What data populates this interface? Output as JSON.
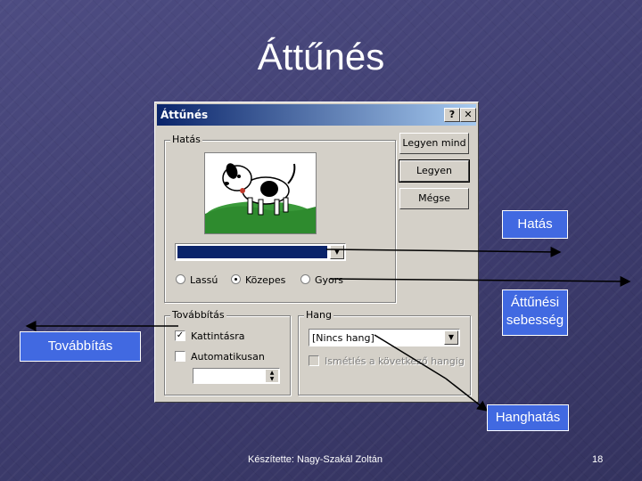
{
  "slide": {
    "title": "Áttűnés",
    "footer_author": "Készítette: Nagy-Szakál Zoltán",
    "page_number": "18"
  },
  "dialog": {
    "title": "Áttűnés",
    "help_button": "?",
    "close_button": "✕",
    "effect_group_label": "Hatás",
    "picture_icon": "dog-picture-icon",
    "effect_select_value": "",
    "speed_options": [
      {
        "label": "Lassú",
        "selected": false
      },
      {
        "label": "Közepes",
        "selected": true
      },
      {
        "label": "Gyors",
        "selected": false
      }
    ],
    "buttons": {
      "apply_all": "Legyen mind",
      "apply": "Legyen",
      "cancel": "Mégse"
    },
    "advance_group_label": "Továbbítás",
    "advance_on_click": "Kattintásra",
    "advance_on_click_checked": true,
    "advance_auto": "Automatikusan",
    "advance_auto_checked": false,
    "advance_auto_value": "",
    "sound_group_label": "Hang",
    "sound_select_value": "[Nincs hang]",
    "loop_sound_label": "Ismétlés a következő hangig",
    "loop_sound_checked": false
  },
  "callouts": {
    "effect": "Hatás",
    "speed": "Áttűnési sebesség",
    "advance": "Továbbítás",
    "sound": "Hanghatás"
  },
  "colors": {
    "background": "#3f3e72",
    "callout": "#4169e1",
    "titlebar_start": "#0a246a",
    "titlebar_end": "#a6caf0",
    "dialog_face": "#d4d0c8"
  }
}
